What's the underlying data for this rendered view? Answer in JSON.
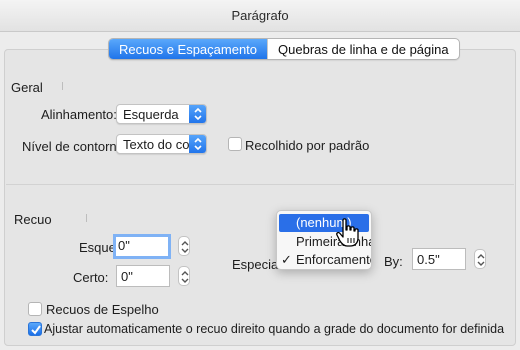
{
  "window": {
    "title": "Parágrafo"
  },
  "tabs": [
    {
      "label": "Recuos e Espaçamento",
      "active": true
    },
    {
      "label": "Quebras de linha e de página",
      "active": false
    }
  ],
  "geral": {
    "heading": "Geral",
    "alinhamento_label": "Alinhamento:",
    "alinhamento_value": "Esquerda",
    "nivel_label": "Nível de contorno:",
    "nivel_value": "Texto do corpo",
    "recolhido_label": "Recolhido por padrão",
    "recolhido_checked": false
  },
  "recuo": {
    "heading": "Recuo",
    "esquerda_label": "Esquerda:",
    "esquerda_value": "0\"",
    "certo_label": "Certo:",
    "certo_value": "0\"",
    "especial_label": "Especial",
    "by_label": "By:",
    "by_value": "0.5\"",
    "menu_options": [
      {
        "label": "(nenhum)",
        "highlighted": true,
        "checked": false
      },
      {
        "label": "Primeira linha",
        "highlighted": false,
        "checked": false
      },
      {
        "label": "Enforcamento",
        "highlighted": false,
        "checked": true
      }
    ]
  },
  "options": {
    "espelho_label": "Recuos de Espelho",
    "espelho_checked": false,
    "ajustar_label": "Ajustar automaticamente o recuo direito quando a grade do documento for definida",
    "ajustar_checked": true
  },
  "colors": {
    "accent": "#1a6fe8",
    "highlight": "#2a6fe8",
    "focus_ring": "#7fb2f5"
  }
}
